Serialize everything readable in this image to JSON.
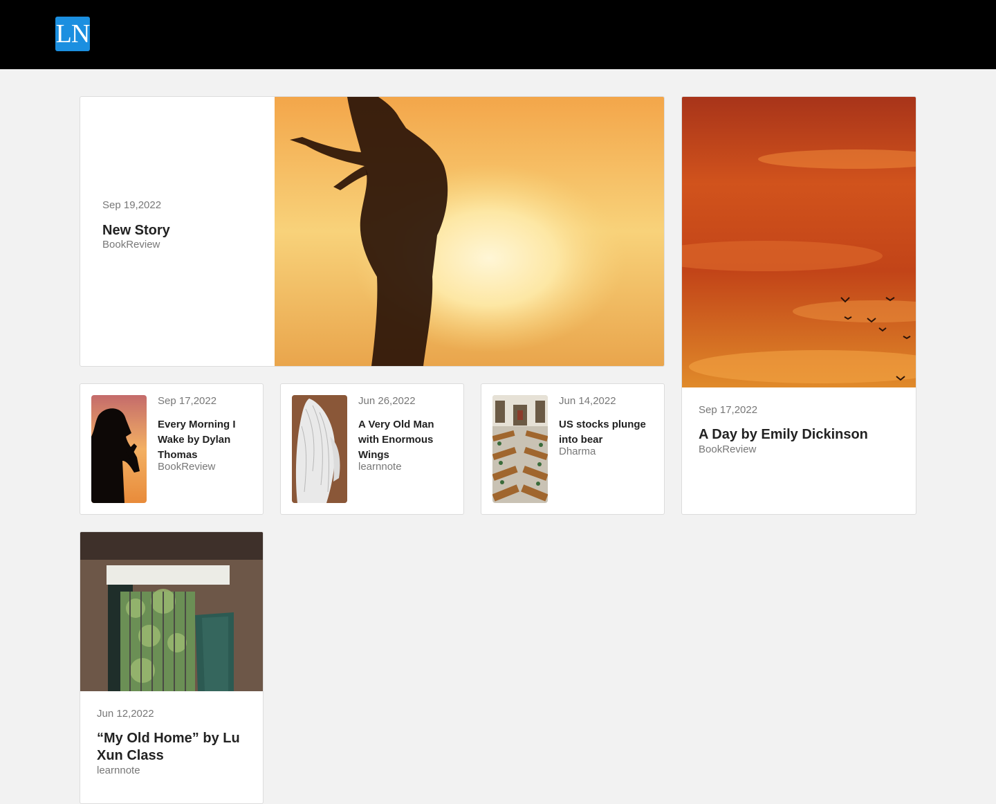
{
  "header": {
    "logo_text": "LN",
    "logo_color": "#1b8fe0",
    "background": "#000000"
  },
  "featured": {
    "date": "Sep 19,2022",
    "title": "New Story",
    "category": "BookReview",
    "image": "silhouette-dancer-sunset-image"
  },
  "side_post": {
    "date": "Sep 17,2022",
    "title": "A Day by Emily Dickinson",
    "category": "BookReview",
    "image": "orange-sky-birds-image"
  },
  "small_posts": [
    {
      "date": "Sep 17,2022",
      "title": "Every Morning I Wake by Dylan Thomas",
      "category": "BookReview",
      "image": "praying-silhouette-image"
    },
    {
      "date": "Jun 26,2022",
      "title": "A Very Old Man with Enormous Wings",
      "category": "learnnote",
      "image": "angel-wings-image"
    },
    {
      "date": "Jun 14,2022",
      "title": "US stocks plunge into bear",
      "category": "Dharma",
      "image": "library-hall-image"
    }
  ],
  "bottom_post": {
    "date": "Jun 12,2022",
    "title": "“My Old Home” by Lu Xun Class",
    "category": "learnnote",
    "image": "old-window-image"
  }
}
